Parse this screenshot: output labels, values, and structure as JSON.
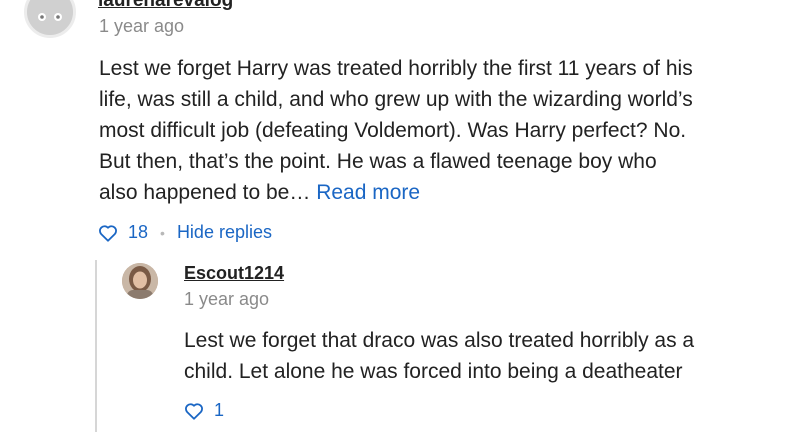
{
  "comment": {
    "username": "laurenarevalog",
    "timestamp": "1 year ago",
    "body_lines": [
      "Lest we forget Harry was treated horribly the first 11 years of his",
      "life, was still a child, and who grew up with the wizarding world’s",
      "most difficult job (defeating Voldemort). Was Harry perfect? No.",
      "But then, that’s the point. He was a flawed teenage boy who",
      "also happened to be…"
    ],
    "read_more": "Read more",
    "like_count": "18",
    "hide_replies": "Hide replies"
  },
  "reply": {
    "username": "Escout1214",
    "timestamp": "1 year ago",
    "body_lines": [
      "Lest we forget that draco was also treated horribly as a",
      "child. Let alone he was forced into being a deatheater"
    ],
    "like_count": "1"
  },
  "colors": {
    "link": "#1a66c4",
    "text": "#222222",
    "muted": "#8a8a8a"
  }
}
